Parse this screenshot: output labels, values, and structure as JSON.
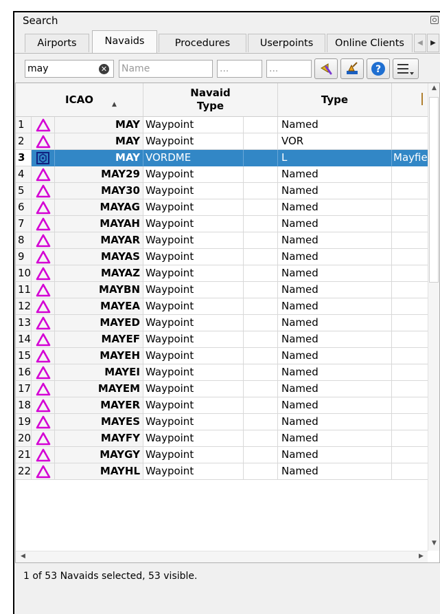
{
  "window": {
    "title": "Search"
  },
  "tabs": [
    {
      "label": "Airports"
    },
    {
      "label": "Navaids",
      "active": true
    },
    {
      "label": "Procedures"
    },
    {
      "label": "Userpoints"
    },
    {
      "label": "Online Clients"
    }
  ],
  "filters": {
    "ident_value": "may",
    "name_placeholder": "Name",
    "field3_placeholder": "...",
    "field4_placeholder": "..."
  },
  "toolbar_icons": [
    "clear-selection-icon",
    "reset-search-icon",
    "help-icon",
    "menu-icon"
  ],
  "table": {
    "headers": {
      "icao": "ICAO",
      "navaid_type": "Navaid Type",
      "type": "Type"
    },
    "sort": "ascending",
    "rows": [
      {
        "num": "1",
        "icao": "MAY",
        "navaid_type": "Waypoint",
        "type": "Named",
        "extra": "",
        "icon": "waypoint-icon"
      },
      {
        "num": "2",
        "icao": "MAY",
        "navaid_type": "Waypoint",
        "type": "VOR",
        "extra": "",
        "icon": "waypoint-icon"
      },
      {
        "num": "3",
        "icao": "MAY",
        "navaid_type": "VORDME",
        "type": "L",
        "extra": "Mayfie",
        "icon": "vordme-icon",
        "selected": true
      },
      {
        "num": "4",
        "icao": "MAY29",
        "navaid_type": "Waypoint",
        "type": "Named",
        "extra": "",
        "icon": "waypoint-icon"
      },
      {
        "num": "5",
        "icao": "MAY30",
        "navaid_type": "Waypoint",
        "type": "Named",
        "extra": "",
        "icon": "waypoint-icon"
      },
      {
        "num": "6",
        "icao": "MAYAG",
        "navaid_type": "Waypoint",
        "type": "Named",
        "extra": "",
        "icon": "waypoint-icon"
      },
      {
        "num": "7",
        "icao": "MAYAH",
        "navaid_type": "Waypoint",
        "type": "Named",
        "extra": "",
        "icon": "waypoint-icon"
      },
      {
        "num": "8",
        "icao": "MAYAR",
        "navaid_type": "Waypoint",
        "type": "Named",
        "extra": "",
        "icon": "waypoint-icon"
      },
      {
        "num": "9",
        "icao": "MAYAS",
        "navaid_type": "Waypoint",
        "type": "Named",
        "extra": "",
        "icon": "waypoint-icon"
      },
      {
        "num": "10",
        "icao": "MAYAZ",
        "navaid_type": "Waypoint",
        "type": "Named",
        "extra": "",
        "icon": "waypoint-icon"
      },
      {
        "num": "11",
        "icao": "MAYBN",
        "navaid_type": "Waypoint",
        "type": "Named",
        "extra": "",
        "icon": "waypoint-icon"
      },
      {
        "num": "12",
        "icao": "MAYEA",
        "navaid_type": "Waypoint",
        "type": "Named",
        "extra": "",
        "icon": "waypoint-icon"
      },
      {
        "num": "13",
        "icao": "MAYED",
        "navaid_type": "Waypoint",
        "type": "Named",
        "extra": "",
        "icon": "waypoint-icon"
      },
      {
        "num": "14",
        "icao": "MAYEF",
        "navaid_type": "Waypoint",
        "type": "Named",
        "extra": "",
        "icon": "waypoint-icon"
      },
      {
        "num": "15",
        "icao": "MAYEH",
        "navaid_type": "Waypoint",
        "type": "Named",
        "extra": "",
        "icon": "waypoint-icon"
      },
      {
        "num": "16",
        "icao": "MAYEI",
        "navaid_type": "Waypoint",
        "type": "Named",
        "extra": "",
        "icon": "waypoint-icon"
      },
      {
        "num": "17",
        "icao": "MAYEM",
        "navaid_type": "Waypoint",
        "type": "Named",
        "extra": "",
        "icon": "waypoint-icon"
      },
      {
        "num": "18",
        "icao": "MAYER",
        "navaid_type": "Waypoint",
        "type": "Named",
        "extra": "",
        "icon": "waypoint-icon"
      },
      {
        "num": "19",
        "icao": "MAYES",
        "navaid_type": "Waypoint",
        "type": "Named",
        "extra": "",
        "icon": "waypoint-icon"
      },
      {
        "num": "20",
        "icao": "MAYFY",
        "navaid_type": "Waypoint",
        "type": "Named",
        "extra": "",
        "icon": "waypoint-icon"
      },
      {
        "num": "21",
        "icao": "MAYGY",
        "navaid_type": "Waypoint",
        "type": "Named",
        "extra": "",
        "icon": "waypoint-icon"
      },
      {
        "num": "22",
        "icao": "MAYHL",
        "navaid_type": "Waypoint",
        "type": "Named",
        "extra": "",
        "icon": "waypoint-icon"
      }
    ]
  },
  "status": {
    "text": "1 of 53 Navaids selected, 53 visible."
  },
  "colors": {
    "selection": "#3287c6",
    "waypoint": "#d400d4",
    "vordme": "#102080"
  }
}
